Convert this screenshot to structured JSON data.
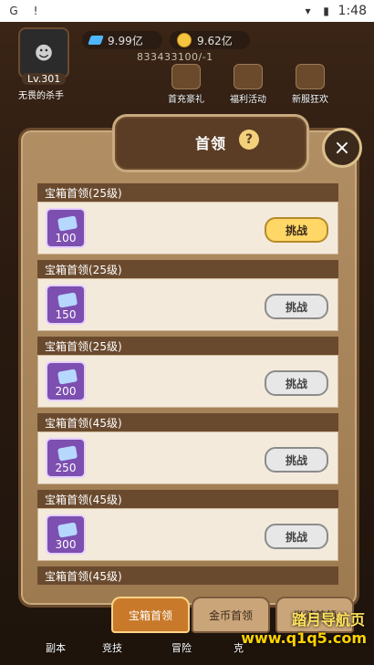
{
  "status": {
    "time": "1:48",
    "left_icons": [
      "G",
      "!"
    ]
  },
  "top": {
    "avatar_level": "Lv.301",
    "player_name": "无畏的杀手",
    "gems": "9.99亿",
    "gold": "9.62亿",
    "ids": "833433100/-1",
    "activities": [
      "首充豪礼",
      "福利活动",
      "新服狂欢"
    ]
  },
  "modal": {
    "title": "首领",
    "help_icon": "?",
    "close_icon": "×",
    "items": [
      {
        "header": "宝箱首领(25级)",
        "chest_count": "100",
        "button": "挑战",
        "active": true
      },
      {
        "header": "宝箱首领(25级)",
        "chest_count": "150",
        "button": "挑战",
        "active": false
      },
      {
        "header": "宝箱首领(25级)",
        "chest_count": "200",
        "button": "挑战",
        "active": false
      },
      {
        "header": "宝箱首领(45级)",
        "chest_count": "250",
        "button": "挑战",
        "active": false
      },
      {
        "header": "宝箱首领(45级)",
        "chest_count": "300",
        "button": "挑战",
        "active": false
      },
      {
        "header": "宝箱首领(45级)",
        "chest_count": "",
        "button": "",
        "active": false
      }
    ],
    "tabs": [
      "宝箱首领",
      "金币首领",
      "坐骑首领"
    ]
  },
  "bottom_nav": [
    "副本",
    "竞技",
    "冒险",
    "克"
  ],
  "watermark": {
    "top": "踏月导航页",
    "bottom": "www.q1q5.com"
  }
}
